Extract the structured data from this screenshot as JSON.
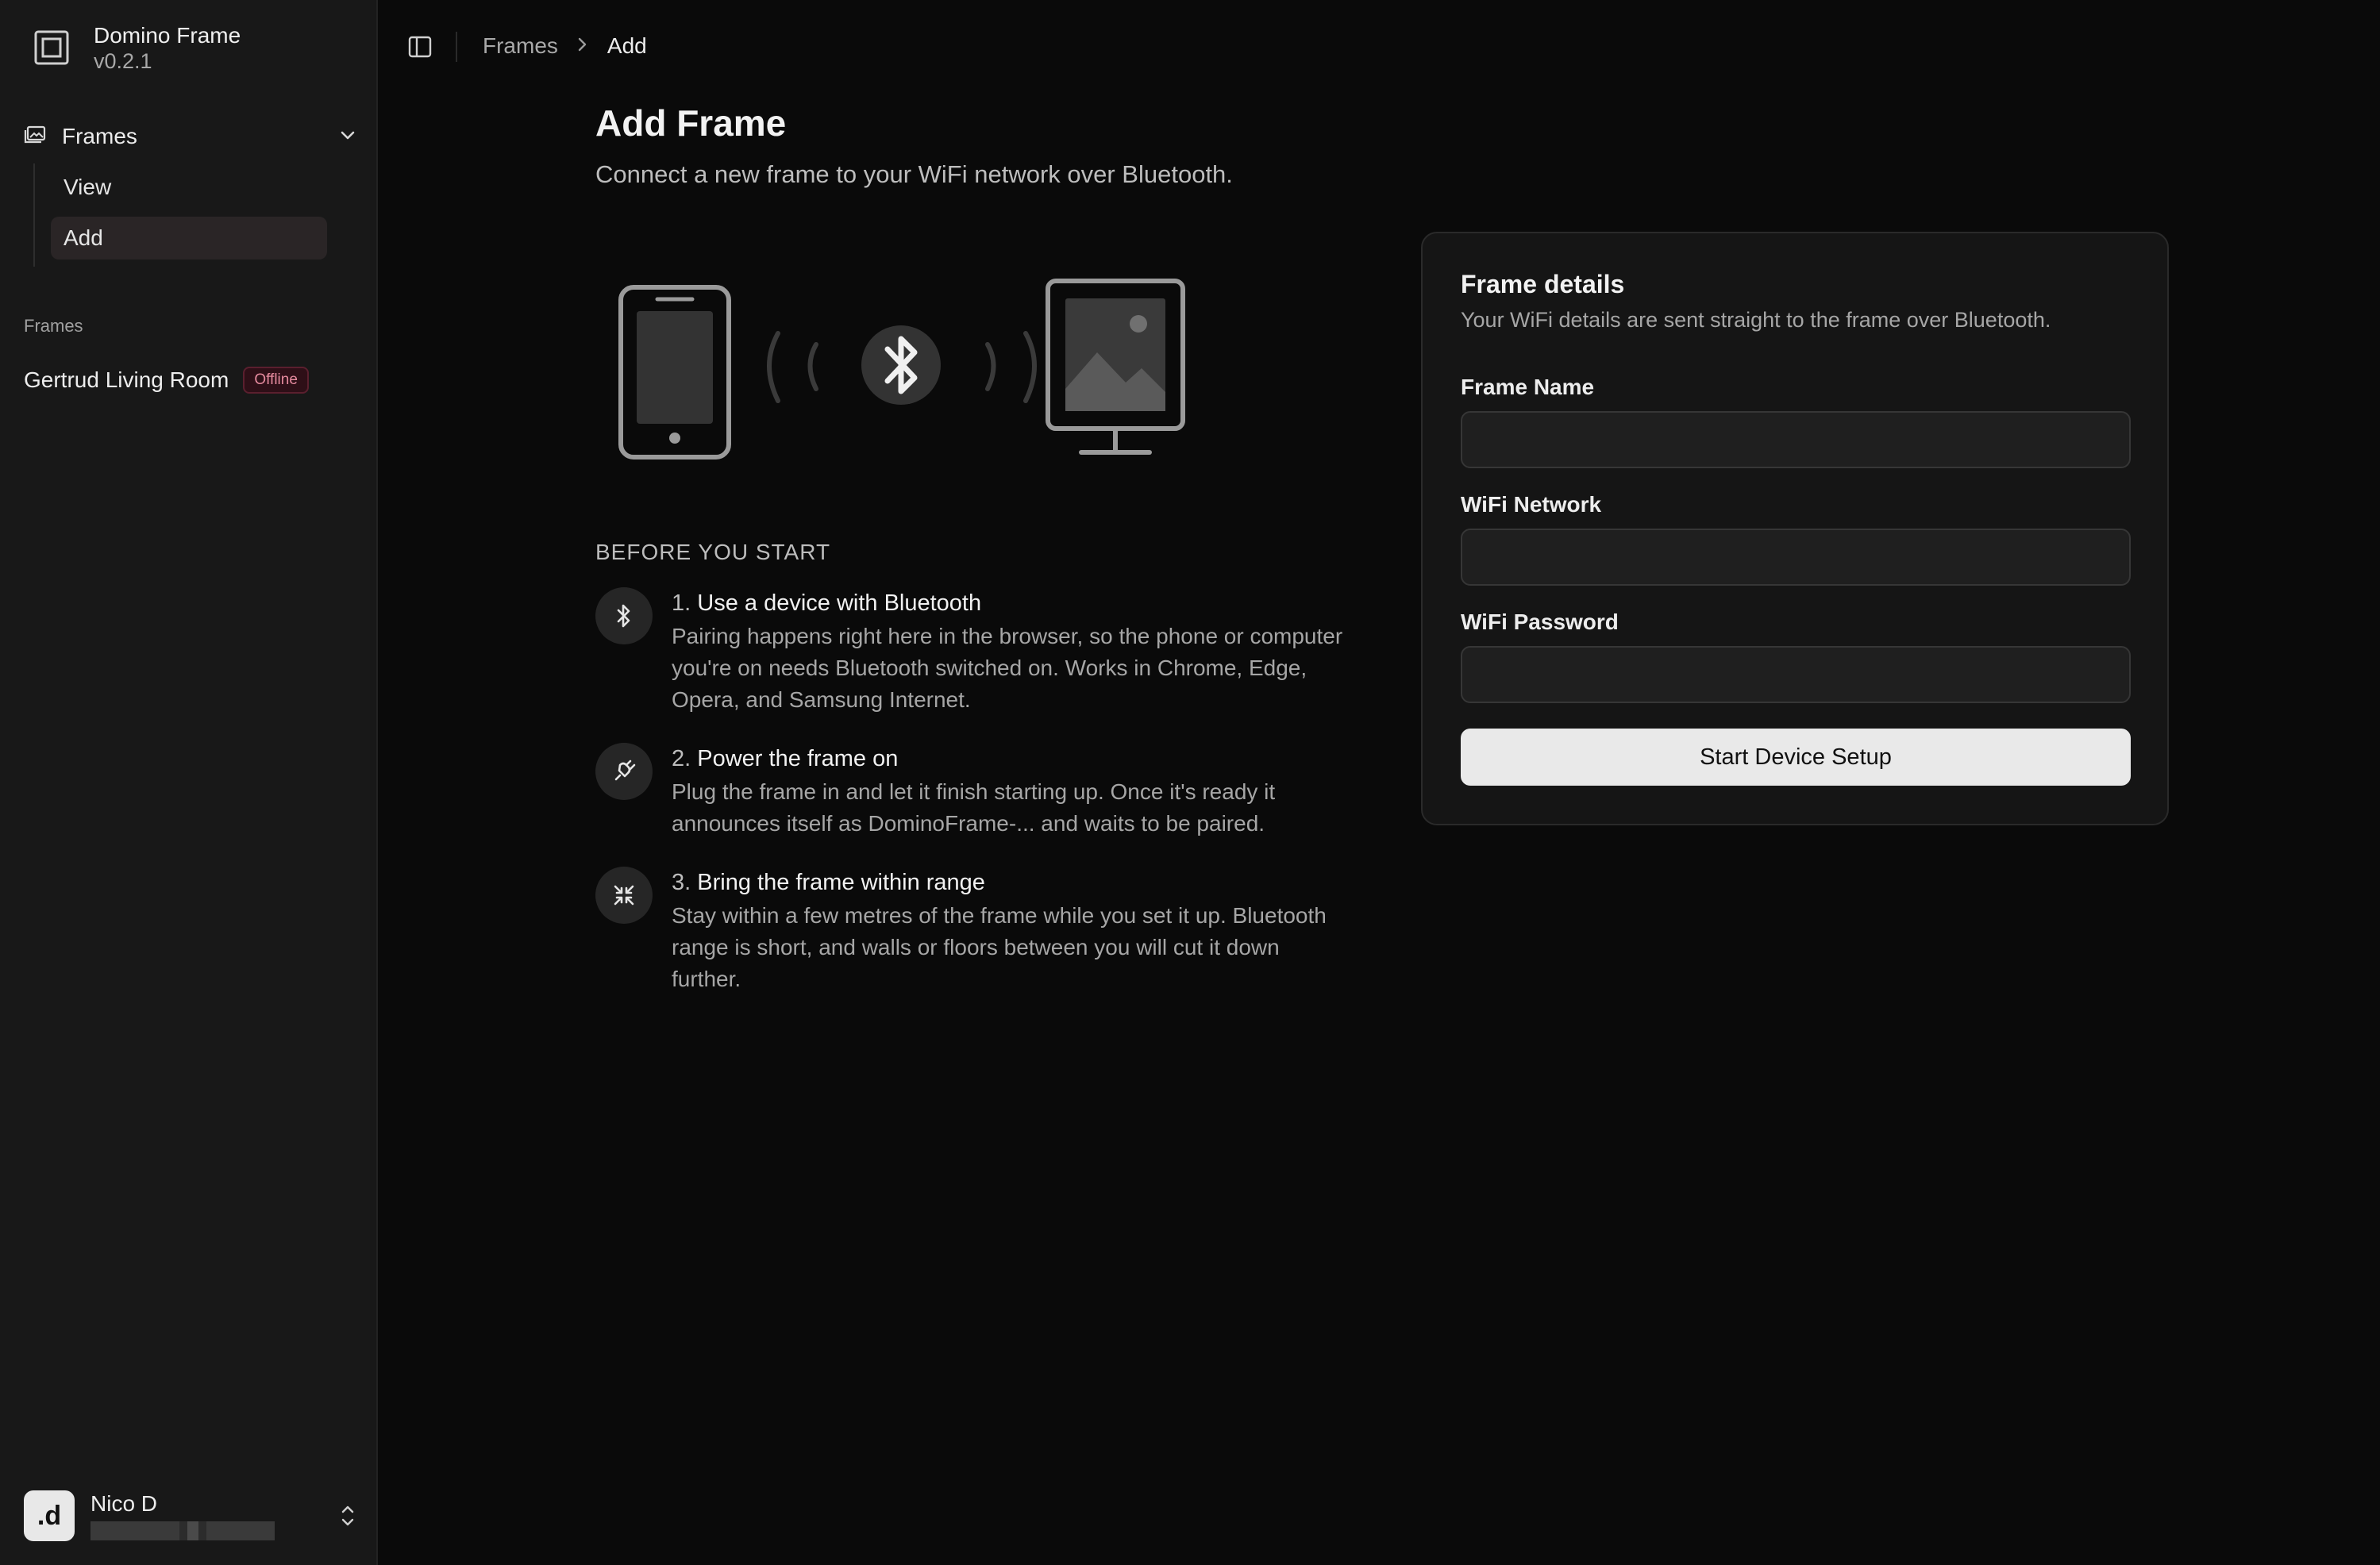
{
  "app": {
    "name": "Domino Frame",
    "version": "v0.2.1"
  },
  "sidebar": {
    "group_label": "Frames",
    "sub_items": [
      "View",
      "Add"
    ],
    "section_label": "Frames",
    "frames": [
      {
        "name": "Gertrud Living Room",
        "status": "Offline"
      }
    ],
    "user": {
      "name": "Nico D",
      "avatar_letter": ".d"
    }
  },
  "breadcrumb": {
    "parent": "Frames",
    "current": "Add"
  },
  "page": {
    "title": "Add Frame",
    "subtitle": "Connect a new frame to your WiFi network over Bluetooth."
  },
  "before": {
    "label": "BEFORE YOU START",
    "steps": [
      {
        "num": "1.",
        "title": "Use a device with Bluetooth",
        "desc": "Pairing happens right here in the browser, so the phone or computer you're on needs Bluetooth switched on. Works in Chrome, Edge, Opera, and Samsung Internet.",
        "icon": "bluetooth-icon"
      },
      {
        "num": "2.",
        "title": "Power the frame on",
        "desc": "Plug the frame in and let it finish starting up. Once it's ready it announces itself as DominoFrame-... and waits to be paired.",
        "icon": "plug-icon"
      },
      {
        "num": "3.",
        "title": "Bring the frame within range",
        "desc": "Stay within a few metres of the frame while you set it up. Bluetooth range is short, and walls or floors between you will cut it down further.",
        "icon": "shrink-icon"
      }
    ]
  },
  "form": {
    "title": "Frame details",
    "subtitle": "Your WiFi details are sent straight to the frame over Bluetooth.",
    "fields": [
      {
        "label": "Frame Name",
        "value": ""
      },
      {
        "label": "WiFi Network",
        "value": ""
      },
      {
        "label": "WiFi Password",
        "value": ""
      }
    ],
    "submit_label": "Start Device Setup"
  },
  "colors": {
    "background": "#0a0a0a",
    "sidebar": "#181818",
    "badge_text": "#e58a9e",
    "button": "#e9e9e9"
  }
}
